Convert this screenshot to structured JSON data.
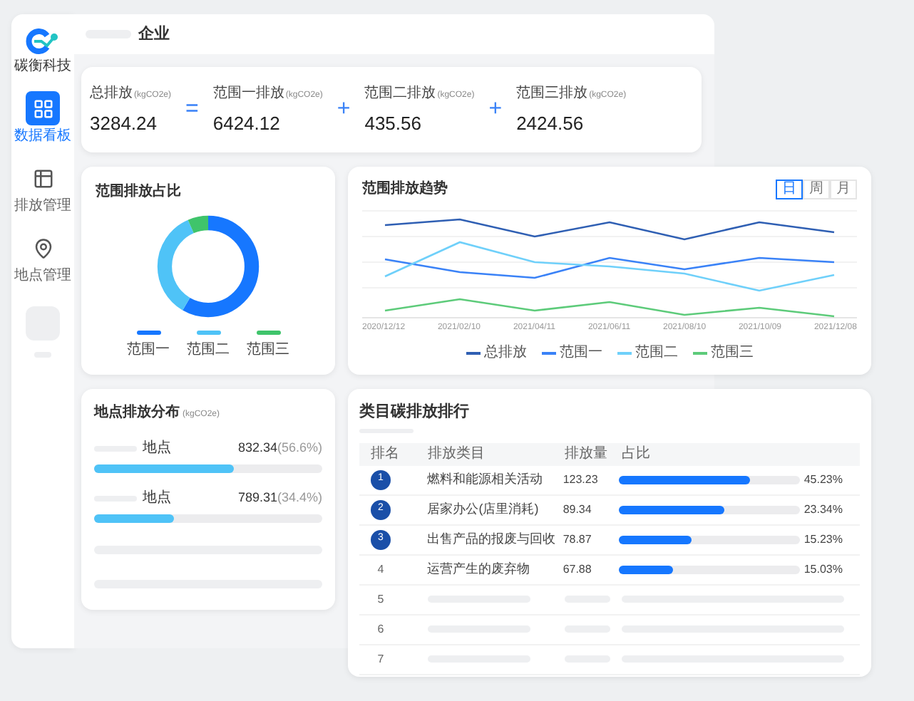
{
  "brand": {
    "name": "碳衡科技"
  },
  "sidebar": {
    "items": [
      {
        "label": "数据看板",
        "selected": true
      },
      {
        "label": "排放管理",
        "selected": false
      },
      {
        "label": "地点管理",
        "selected": false
      }
    ]
  },
  "header": {
    "title": "企业"
  },
  "summary": {
    "items": [
      {
        "label": "总排放",
        "unit": "(kgCO2e)",
        "value": "3284.24"
      },
      {
        "operator": "=",
        "label": "范围一排放",
        "unit": "(kgCO2e)",
        "value": "6424.12"
      },
      {
        "operator": "+",
        "label": "范围二排放",
        "unit": "(kgCO2e)",
        "value": "435.56"
      },
      {
        "operator": "+",
        "label": "范围三排放",
        "unit": "(kgCO2e)",
        "value": "2424.56"
      }
    ]
  },
  "share_card": {
    "title": "范围排放占比",
    "legend": [
      {
        "label": "范围一",
        "color": "#1677ff"
      },
      {
        "label": "范围二",
        "color": "#4fc3f7"
      },
      {
        "label": "范围三",
        "color": "#3fc46b"
      }
    ]
  },
  "trend_card": {
    "title": "范围排放趋势",
    "tabs": [
      {
        "label": "日",
        "selected": true
      },
      {
        "label": "周",
        "selected": false
      },
      {
        "label": "月",
        "selected": false
      }
    ],
    "x_labels": [
      "2020/12/12",
      "2021/02/10",
      "2021/04/11",
      "2021/06/11",
      "2021/08/10",
      "2021/10/09",
      "2021/12/08"
    ],
    "legend": [
      {
        "label": "总排放",
        "color": "#2f5fb3"
      },
      {
        "label": "范围一",
        "color": "#3a82f7"
      },
      {
        "label": "范围二",
        "color": "#6fd0fa"
      },
      {
        "label": "范围三",
        "color": "#5dcb7a"
      }
    ]
  },
  "location_card": {
    "title": "地点排放分布",
    "unit": "(kgCO2e)",
    "items": [
      {
        "name": "地点",
        "value": "832.34",
        "share": "(56.6%)",
        "level": 0.61
      },
      {
        "name": "地点",
        "value": "789.31",
        "share": "(34.4%)",
        "level": 0.35
      }
    ]
  },
  "ranking_card": {
    "title": "类目碳排放排行",
    "columns": [
      "排名",
      "排放类目",
      "排放量",
      "占比"
    ],
    "rows": [
      {
        "kind": "badge",
        "rank": "1",
        "category": "燃料和能源相关活动",
        "amount": "123.23",
        "level": 0.72,
        "share": "45.23%"
      },
      {
        "kind": "badge",
        "rank": "2",
        "category": "居家办公(店里消耗)",
        "amount": "89.34",
        "level": 0.58,
        "share": "23.34%"
      },
      {
        "kind": "badge",
        "rank": "3",
        "category": "出售产品的报废与回收",
        "amount": "78.87",
        "level": 0.4,
        "share": "15.23%"
      },
      {
        "kind": "plain",
        "rank": "4",
        "category": "运营产生的废弃物",
        "amount": "67.88",
        "level": 0.3,
        "share": "15.03%"
      },
      {
        "kind": "placeholder",
        "rank": "5"
      },
      {
        "kind": "placeholder",
        "rank": "6"
      },
      {
        "kind": "placeholder",
        "rank": "7"
      }
    ]
  }
}
